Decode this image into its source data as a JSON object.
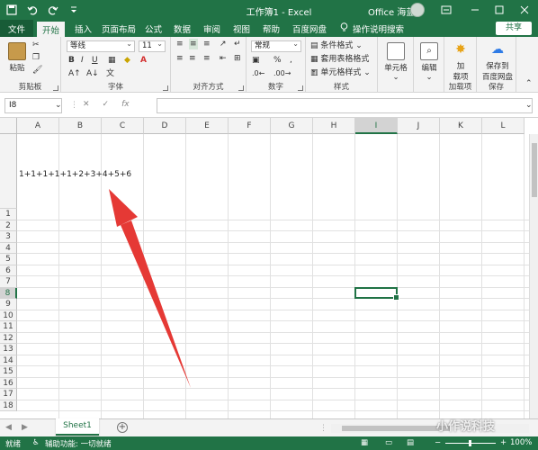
{
  "window": {
    "title": "工作簿1 - Excel",
    "account": "Office 海蓝"
  },
  "tabs": [
    "文件",
    "开始",
    "插入",
    "页面布局",
    "公式",
    "数据",
    "审阅",
    "视图",
    "帮助",
    "百度网盘"
  ],
  "tell_me": "操作说明搜索",
  "share_label": "共享",
  "ribbon": {
    "clipboard": {
      "paste": "粘贴",
      "group": "剪贴板"
    },
    "font": {
      "name": "等线",
      "size": "11",
      "group": "字体"
    },
    "alignment": {
      "group": "对齐方式"
    },
    "number": {
      "format": "常规",
      "group": "数字"
    },
    "styles": {
      "conditional": "条件格式",
      "table": "套用表格格式",
      "cell_styles": "单元格样式",
      "group": "样式"
    },
    "cells": {
      "label": "单元格"
    },
    "editing": {
      "label": "编辑"
    },
    "addins": {
      "label_line1": "加",
      "label_line2": "载项",
      "group": "加载项"
    },
    "save": {
      "label_line1": "保存到",
      "label_line2": "百度网盘",
      "group": "保存"
    }
  },
  "formula_bar": {
    "name_box": "I8",
    "fx": "fx",
    "content": ""
  },
  "columns": [
    "A",
    "B",
    "C",
    "D",
    "E",
    "F",
    "G",
    "H",
    "I",
    "J",
    "K",
    "L"
  ],
  "rows": [
    "1",
    "2",
    "3",
    "4",
    "5",
    "6",
    "7",
    "8",
    "9",
    "10",
    "11",
    "12",
    "13",
    "14",
    "15",
    "16",
    "17",
    "18"
  ],
  "selected_cell": {
    "column": "I",
    "row": "8"
  },
  "cell_text": "1+1+1+1+1+2+3+4+5+6",
  "sheet_tab": "Sheet1",
  "status": {
    "ready": "就绪",
    "accessibility": "辅助功能: 一切就绪",
    "zoom": "100%"
  },
  "watermark": "小作说科技",
  "colors": {
    "brand": "#217346",
    "arrow": "#e53935"
  }
}
